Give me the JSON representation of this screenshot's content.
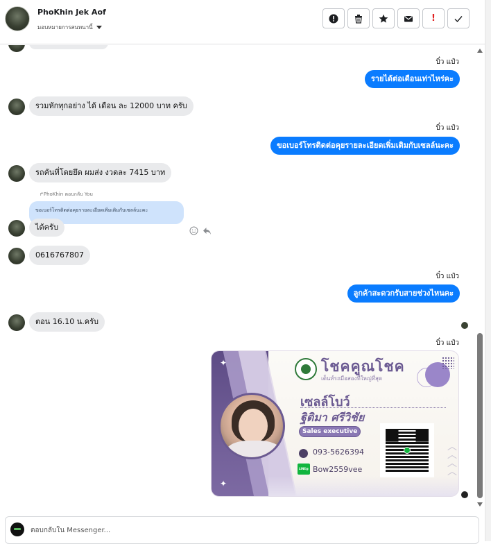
{
  "header": {
    "contact_name": "PhoKhin Jek Aof",
    "assign_label": "มอบหมายการสนทนานี้",
    "toolbar": [
      {
        "name": "report-button",
        "icon": "exclamation-circle-icon"
      },
      {
        "name": "delete-button",
        "icon": "trash-icon"
      },
      {
        "name": "star-button",
        "icon": "star-icon"
      },
      {
        "name": "mark-unread-button",
        "icon": "envelope-icon"
      },
      {
        "name": "spam-button",
        "icon": "exclamation-red-icon",
        "label": "!"
      },
      {
        "name": "done-button",
        "icon": "check-icon"
      }
    ]
  },
  "messages": {
    "m1_seen": "บิ๋ว แป๋ว",
    "m1_text": "รายได้ต่อเดือนเท่าไหร่คะ",
    "m2_text": "รวมหักทุกอย่าง ได้ เดือน ละ 12000  บาท ครับ",
    "m3_seen": "บิ๋ว แป๋ว",
    "m3_text": "ขอเบอร์โทรติดต่อคุยรายละเอียดเพิ่มเติมกับเซลล์นะคะ",
    "m4_text": "รถคันที่โดยยึด ผมส่ง งวดละ 7415 บาท",
    "reply_meta": "↱PhoKhin ตอบกลับ You",
    "quoted_text": "ขอเบอร์โทรติดต่อคุยรายละเอียดเพิ่มเติมกับเซลล์นะคะ",
    "m5_text": "ได้ครับ",
    "m6_text": "0616767807",
    "m7_seen": "บิ๋ว แป๋ว",
    "m7_text": "ลูกค้าสะดวกรับสายช่วงไหนคะ",
    "m8_text": "ตอน 16.10  น.ครับ",
    "m9_seen": "บิ๋ว แป๋ว"
  },
  "card": {
    "brand": "โชคคูณโชค",
    "brand_sub": "เต็นท์รถมือสองที่ใหญ่ที่สุด",
    "nickname": "เซลล์โบว์",
    "fullname": "ฐิติมา  ศรีวิชัย",
    "role": "Sales executive",
    "phone": "093-5626394",
    "line_badge": "LINE@",
    "line_id": "Bow2559vee",
    "sparkle": "✦"
  },
  "composer": {
    "placeholder": "ตอบกลับใน Messenger..."
  },
  "colors": {
    "outgoing_bubble": "#0a7cff",
    "incoming_bubble": "#e9eaec",
    "quoted_bubble": "#cfe3fc",
    "card_purple": "#6b5a92"
  }
}
